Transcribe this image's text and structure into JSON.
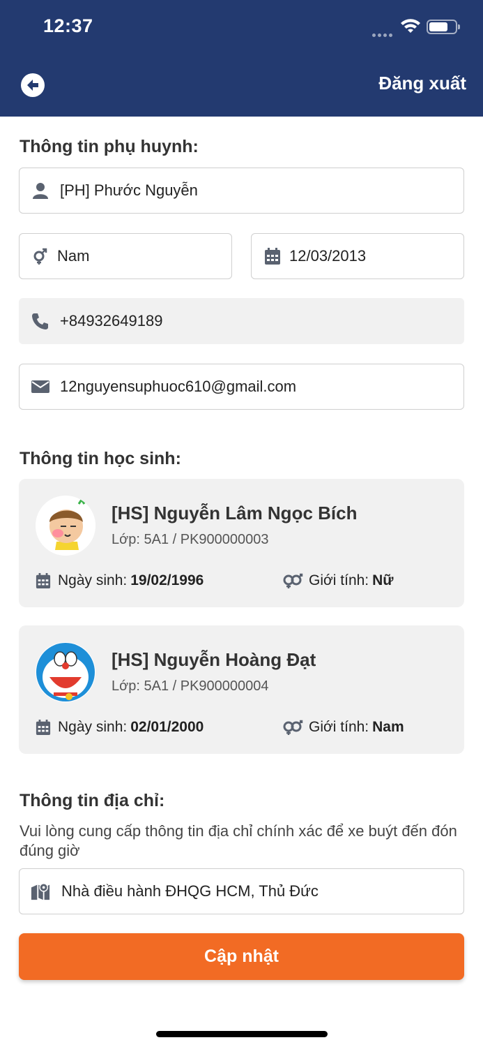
{
  "status_bar": {
    "time": "12:37"
  },
  "header": {
    "logout_label": "Đăng xuất"
  },
  "parent": {
    "section_title": "Thông tin phụ huynh:",
    "name": "[PH] Phước Nguyễn",
    "gender": "Nam",
    "birthdate": "12/03/2013",
    "phone": "+84932649189",
    "email": "12nguyensuphuoc610@gmail.com"
  },
  "students": {
    "section_title": "Thông tin học sinh:",
    "birth_label": "Ngày sinh:",
    "gender_label": "Giới tính:",
    "items": [
      {
        "name": "[HS] Nguyễn Lâm Ngọc Bích",
        "class_info": "Lớp: 5A1 / PK900000003",
        "birthdate": "19/02/1996",
        "gender": "Nữ"
      },
      {
        "name": "[HS] Nguyễn Hoàng Đạt",
        "class_info": "Lớp: 5A1 / PK900000004",
        "birthdate": "02/01/2000",
        "gender": "Nam"
      }
    ]
  },
  "address": {
    "section_title": "Thông tin địa chỉ:",
    "note": "Vui lòng cung cấp thông tin địa chỉ chính xác để xe buýt đến đón đúng giờ",
    "value": "Nhà điều hành ĐHQG HCM, Thủ Đức"
  },
  "update_button": {
    "label": "Cập nhật"
  },
  "colors": {
    "header_bg": "#233a70",
    "accent": "#f26b24",
    "card_bg": "#f1f1f1",
    "icon": "#5a6270"
  }
}
